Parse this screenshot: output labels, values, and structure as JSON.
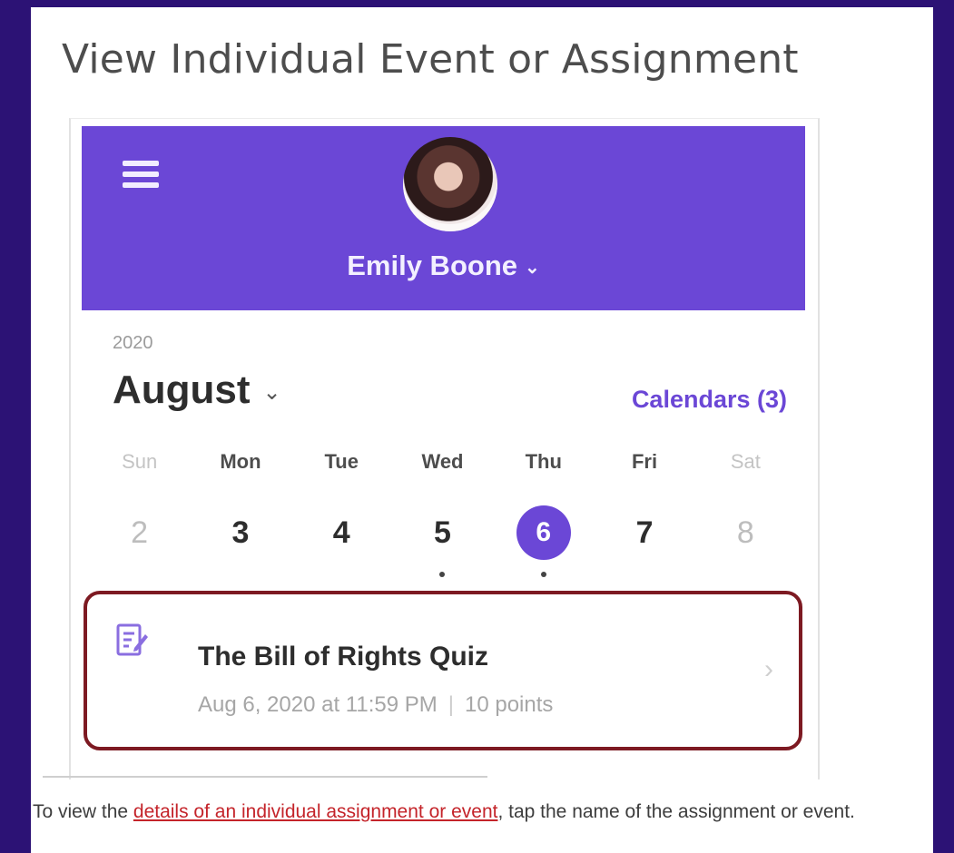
{
  "page": {
    "title": "View Individual Event or Assignment",
    "caption_before": "To view the ",
    "caption_link": "details of an individual assignment or event",
    "caption_after": ", tap the name of the assignment or event."
  },
  "app": {
    "header": {
      "menu_icon": "hamburger-icon",
      "user_name": "Emily Boone",
      "user_menu_icon": "chevron-down-icon"
    },
    "calendar": {
      "year": "2020",
      "month": "August",
      "month_menu_icon": "chevron-down-icon",
      "calendars_link": "Calendars (3)",
      "weekdays": [
        "Sun",
        "Mon",
        "Tue",
        "Wed",
        "Thu",
        "Fri",
        "Sat"
      ],
      "dates": [
        "2",
        "3",
        "4",
        "5",
        "6",
        "7",
        "8"
      ],
      "selected_date": "6",
      "dates_with_events": [
        "5",
        "6"
      ]
    },
    "event": {
      "icon": "assignment-icon",
      "title": "The Bill of Rights Quiz",
      "due": "Aug 6, 2020 at 11:59 PM",
      "separator": "|",
      "points": "10 points",
      "chevron_icon": "chevron-right-icon"
    }
  },
  "colors": {
    "frame_background": "#2c1275",
    "header_purple": "#6b47d6",
    "highlight_border": "#7d1a22",
    "link_red": "#c4242a"
  }
}
